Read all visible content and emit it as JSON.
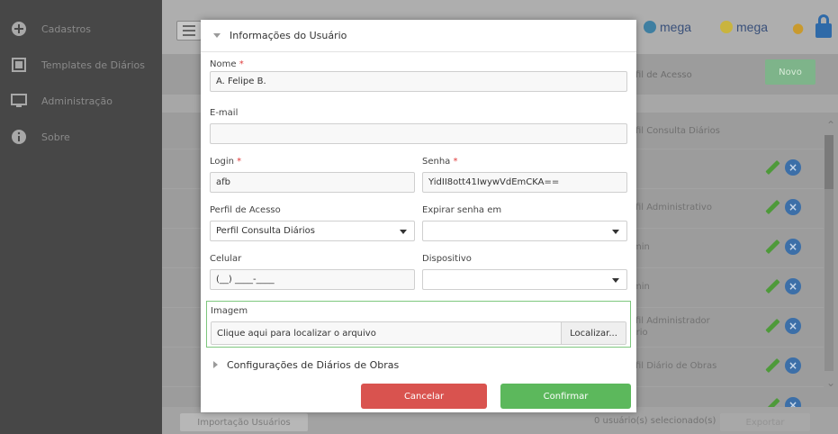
{
  "sidebar": {
    "items": [
      {
        "label": "Cadastros",
        "icon": "plus-circle-icon"
      },
      {
        "label": "Templates de Diários",
        "icon": "template-icon"
      },
      {
        "label": "Administração",
        "icon": "monitor-icon"
      },
      {
        "label": "Sobre",
        "icon": "info-icon"
      }
    ]
  },
  "header": {
    "brand1": "mega",
    "brand2": "mega"
  },
  "table": {
    "column_header": "Perfil de Acesso",
    "new_button": "Novo",
    "filter_value": "Perfil Consulta Diários",
    "rows": [
      {
        "perfil": ""
      },
      {
        "perfil": "Perfil Administrativo"
      },
      {
        "perfil": "Admin"
      },
      {
        "perfil": "Admin"
      },
      {
        "perfil": "Perfil Administrador Diário"
      },
      {
        "perfil": "Perfil Diário de Obras"
      },
      {
        "perfil": ""
      }
    ]
  },
  "bottom": {
    "import_label": "Importação Usuários",
    "selected_count": "0 usuário(s) selecionado(s)",
    "export_label": "Exportar"
  },
  "modal": {
    "section_title": "Informações do Usuário",
    "nome_label": "Nome",
    "nome_value": "A. Felipe B.",
    "email_label": "E-mail",
    "email_value": "",
    "login_label": "Login",
    "login_value": "afb",
    "senha_label": "Senha",
    "senha_value": "YidII8ott41IwywVdEmCKA==",
    "perfil_label": "Perfil de Acesso",
    "perfil_value": "Perfil Consulta Diários",
    "expirar_label": "Expirar senha em",
    "expirar_value": "",
    "celular_label": "Celular",
    "celular_value": "(__) ____-____",
    "dispositivo_label": "Dispositivo",
    "dispositivo_value": "",
    "imagem_label": "Imagem",
    "imagem_placeholder": "Clique aqui para localizar o arquivo",
    "localizar_label": "Localizar...",
    "section2_title": "Configurações de Diários de Obras",
    "cancel_label": "Cancelar",
    "confirm_label": "Confirmar",
    "required_mark": "*"
  },
  "colors": {
    "cancel": "#d9534f",
    "confirm": "#5cb85c",
    "highlight": "#7ec77e"
  }
}
